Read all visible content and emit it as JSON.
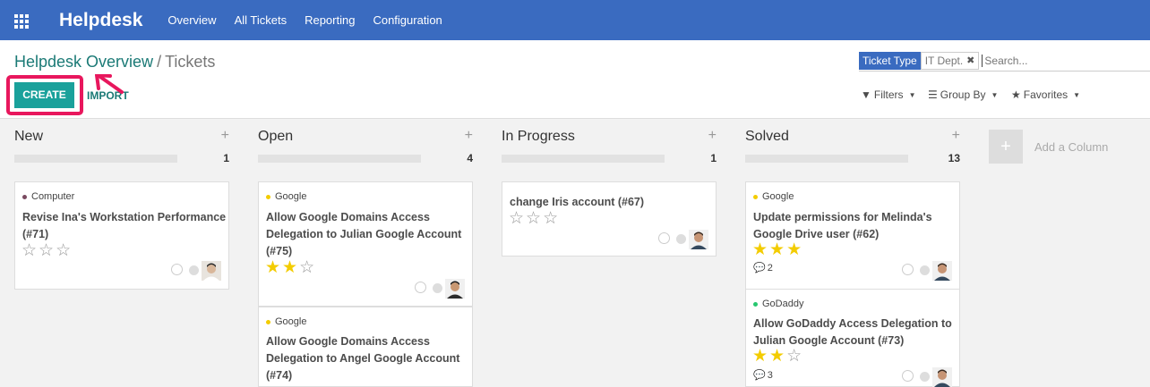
{
  "navbar": {
    "brand": "Helpdesk",
    "items": [
      "Overview",
      "All Tickets",
      "Reporting",
      "Configuration"
    ]
  },
  "breadcrumb": {
    "parent": "Helpdesk Overview",
    "separator": "/",
    "current": "Tickets"
  },
  "buttons": {
    "create": "CREATE",
    "import": "IMPORT"
  },
  "search": {
    "facet_type": "Ticket Type",
    "facet_value": "IT Dept.",
    "placeholder": "Search..."
  },
  "filters": {
    "filters": "Filters",
    "group_by": "Group By",
    "favorites": "Favorites"
  },
  "columns": [
    {
      "title": "New",
      "count": "1"
    },
    {
      "title": "Open",
      "count": "4"
    },
    {
      "title": "In Progress",
      "count": "1"
    },
    {
      "title": "Solved",
      "count": "13"
    }
  ],
  "add_column": "Add a Column",
  "cards": {
    "c71": {
      "tag": "Computer",
      "tag_color": "#7a4a60",
      "title": "Revise Ina's Workstation Performance (#71)",
      "rating": 0
    },
    "c75": {
      "tag": "Google",
      "tag_color": "#f3cc00",
      "title": "Allow Google Domains Access Delegation to Julian Google Account (#75)",
      "rating": 2
    },
    "c74": {
      "tag": "Google",
      "tag_color": "#f3cc00",
      "title": "Allow Google Domains Access Delegation to Angel Google Account (#74)"
    },
    "c67": {
      "title": "change Iris account (#67)",
      "rating": 0
    },
    "c62": {
      "tag": "Google",
      "tag_color": "#f3cc00",
      "title": "Update permissions for Melinda's Google Drive user (#62)",
      "rating": 3,
      "messages": "2"
    },
    "c73": {
      "tag": "GoDaddy",
      "tag_color": "#28c76f",
      "title": "Allow GoDaddy Access Delegation to Julian Google Account (#73)",
      "rating": 2,
      "messages": "3"
    }
  }
}
